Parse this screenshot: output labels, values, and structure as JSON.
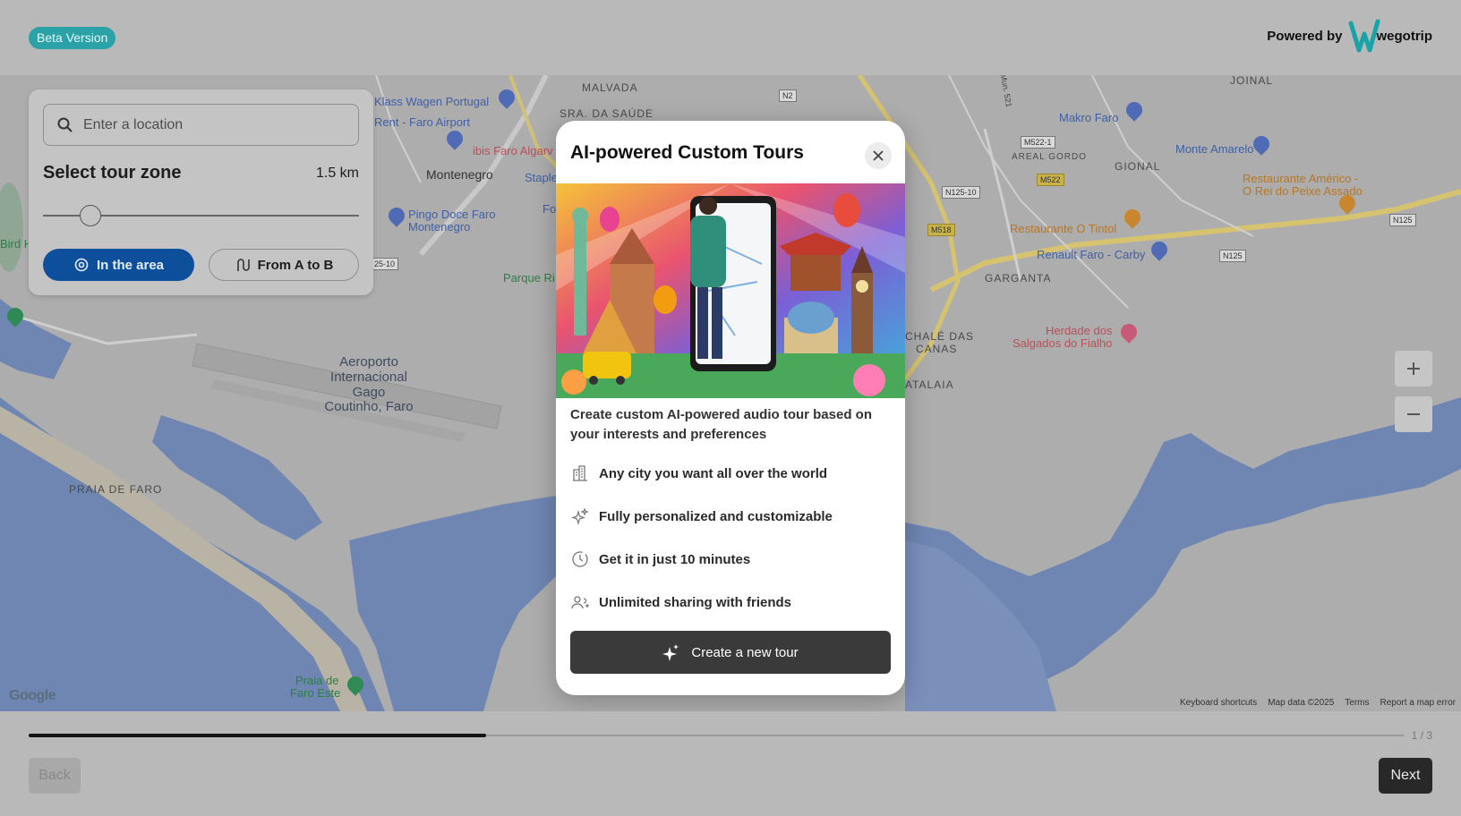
{
  "header": {
    "beta_badge": "Beta Version",
    "powered_by": "Powered by",
    "brand_name": "wegotrip"
  },
  "panel": {
    "search_placeholder": "Enter a location",
    "zone_title": "Select tour zone",
    "zone_distance": "1.5 km",
    "slider_level_fraction": 0.15,
    "mode_area": "In the area",
    "mode_ab": "From A to B"
  },
  "map": {
    "labels": {
      "malvada": "MALVADA",
      "sra_saude": "SRA. DA SAÚDE",
      "montenegro": "Montenegro",
      "klass_wagen": "Klass Wagen Portugal",
      "rent_faro": "Rent - Faro Airport",
      "ibis": "ibis Faro Algarv",
      "pingo_doce_1": "Pingo Doce Faro",
      "pingo_doce_2": "Montenegro",
      "parque": "Parque Ri",
      "airport_1": "Aeroporto",
      "airport_2": "Internacional",
      "airport_3": "Gago",
      "airport_4": "Coutinho, Faro",
      "praia_faro": "PRAIA DE FARO",
      "praia_faro_este_1": "Praia de",
      "praia_faro_este_2": "Faro Este",
      "joinal": "JOINAL",
      "makro": "Makro Faro",
      "areal_gordo": "AREAL GORDO",
      "gional": "GIONAL",
      "monte_amarelo": "Monte Amarelo",
      "restaurante_americo_1": "Restaurante Américo -",
      "restaurante_americo_2": "O Rei do Peixe Assado",
      "restaurante_tintol": "Restaurante O Tintol",
      "renault": "Renault Faro - Carby",
      "garganta": "GARGANTA",
      "chale_1": "CHALÉ DAS",
      "chale_2": "CANAS",
      "atalaia": "ATALAIA",
      "herdade_1": "Herdade dos",
      "herdade_2": "Salgados do Fialho",
      "bird": "Bird H",
      "fo": "Fo",
      "staple": "Staple",
      "mun": "Mun. 521"
    },
    "roads": {
      "n2": "N2",
      "m522_1": "M522-1",
      "m522": "M522",
      "n125_10": "N125-10",
      "m518": "M518",
      "n125_a": "N125",
      "n125_b": "N125",
      "r25_10": "25-10"
    },
    "zoom_in": "+",
    "zoom_out": "−",
    "google": "Google",
    "footer": {
      "shortcuts": "Keyboard shortcuts",
      "map_data": "Map data ©2025",
      "terms": "Terms",
      "report": "Report a map error"
    }
  },
  "modal": {
    "title": "AI-powered Custom Tours",
    "description": "Create custom AI-powered audio tour based on your interests and preferences",
    "features": [
      {
        "icon": "city-icon",
        "text": "Any city you want all over the world"
      },
      {
        "icon": "sparkle-icon",
        "text": "Fully personalized and customizable"
      },
      {
        "icon": "clock-icon",
        "text": "Get it in just 10 minutes"
      },
      {
        "icon": "users-icon",
        "text": "Unlimited sharing with friends"
      }
    ],
    "cta": "Create a new tour"
  },
  "footer": {
    "page_indicator": "1 / 3",
    "progress_fraction": 0.333,
    "back": "Back",
    "next": "Next"
  },
  "colors": {
    "beta_badge": "#2aa2a8",
    "mode_active": "#0e4f9c",
    "cta": "#3a3a3a",
    "next_button": "#282828"
  }
}
